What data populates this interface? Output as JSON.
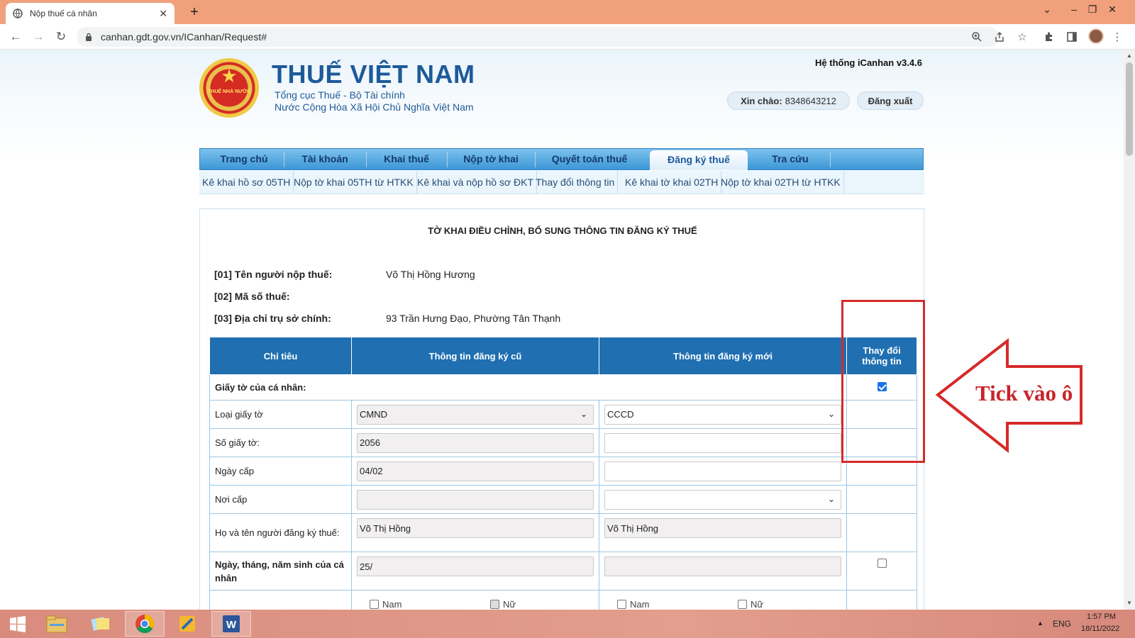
{
  "browser": {
    "tab_title": "Nộp thuế cá nhân",
    "new_tab_label": "+",
    "url": "canhan.gdt.gov.vn/ICanhan/Request#",
    "accent_tabstrip": "#f0a07a"
  },
  "header": {
    "site_title": "THUẾ VIỆT NAM",
    "subtitle_1": "Tổng cục Thuế - Bộ Tài chính",
    "subtitle_2": "Nước Cộng Hòa Xã Hội Chủ Nghĩa Việt Nam",
    "emblem_text": "THUẾ NHÀ NƯỚC",
    "system_version": "Hệ thống iCanhan v3.4.6",
    "greeting_label": "Xin chào:",
    "greeting_user": "8348643212",
    "logout_label": "Đăng xuất"
  },
  "menu": {
    "items": [
      {
        "label": "Trang chủ"
      },
      {
        "label": "Tài khoản"
      },
      {
        "label": "Khai thuế"
      },
      {
        "label": "Nộp tờ khai"
      },
      {
        "label": "Quyết toán thuế"
      },
      {
        "label": "Đăng ký thuế"
      },
      {
        "label": "Tra cứu"
      }
    ],
    "active_item": "Đăng ký thuế",
    "submenu": [
      {
        "label": "Kê khai hồ sơ 05TH"
      },
      {
        "label": "Nộp tờ khai 05TH từ HTKK"
      },
      {
        "label": "Kê khai và nộp hồ sơ ĐKT"
      },
      {
        "label": "Thay đổi thông tin"
      },
      {
        "label": "Kê khai tờ khai 02TH"
      },
      {
        "label": "Nộp tờ khai 02TH từ HTKK"
      }
    ]
  },
  "form": {
    "title": "TỜ KHAI ĐIỀU CHỈNH, BỔ SUNG THÔNG TIN ĐĂNG KÝ THUẾ",
    "taxpayer_name_label": "[01] Tên người nộp thuế:",
    "taxpayer_name_value": "Võ Thị Hồng Hương",
    "tax_code_label": "[02] Mã số thuế:",
    "address_label": "[03] Địa chỉ trụ sở chính:",
    "address_value": "93 Trần Hưng Đạo, Phường Tân Thạnh"
  },
  "table": {
    "headers": {
      "criteria": "Chỉ tiêu",
      "old_info": "Thông tin đăng ký cũ",
      "new_info": "Thông tin đăng ký mới",
      "change": "Thay đổi thông tin"
    },
    "rows": {
      "personal_docs": {
        "label": "Giấy tờ của cá nhân:",
        "change_checked": true
      },
      "doc_type": {
        "label": "Loại giấy tờ",
        "old_value": "CMND",
        "new_value": "CCCD"
      },
      "doc_number": {
        "label": "Số giấy tờ:",
        "old_value": "2056",
        "new_value": ""
      },
      "issue_date": {
        "label": "Ngày cấp",
        "old_value": "04/02",
        "new_value": ""
      },
      "issue_place": {
        "label": "Nơi cấp",
        "old_value": "",
        "new_value": ""
      },
      "full_name": {
        "label": "Họ và tên người đăng ký thuế:",
        "old_value": "Võ Thị Hồng",
        "new_value": "Võ Thị Hồng"
      },
      "birth_date": {
        "label": "Ngày, tháng, năm sinh của cá nhân",
        "old_value": "25/",
        "new_value": "",
        "change_checked": false
      },
      "gender": {
        "male_label": "Nam",
        "female_label": "Nữ",
        "old_female_checked": true
      }
    }
  },
  "annotation": {
    "callout_text": "Tick vào ô",
    "color": "#d62a2a"
  },
  "taskbar": {
    "language": "ENG",
    "time": "1:57 PM",
    "date": "18/11/2022"
  }
}
